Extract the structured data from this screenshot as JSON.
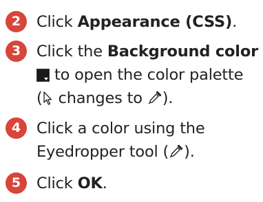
{
  "colors": {
    "badge": "#d8453a",
    "text": "#222222"
  },
  "steps": [
    {
      "number": "2",
      "prefix": "Click ",
      "bold": "Appearance (CSS)",
      "suffix": "."
    },
    {
      "number": "3",
      "line1_prefix": "Click the ",
      "line1_bold": "Background color",
      "line2_suffix": " to open the color palette",
      "line3_prefix": "(",
      "line3_middle": " changes to ",
      "line3_suffix": ").",
      "icons": [
        "color-swatch-icon",
        "arrow-cursor-icon",
        "eyedropper-icon"
      ]
    },
    {
      "number": "4",
      "line1": "Click a color using the",
      "line2_prefix": "Eyedropper tool (",
      "line2_suffix": ").",
      "icons": [
        "eyedropper-icon"
      ]
    },
    {
      "number": "5",
      "prefix": "Click ",
      "bold": "OK",
      "suffix": "."
    }
  ]
}
